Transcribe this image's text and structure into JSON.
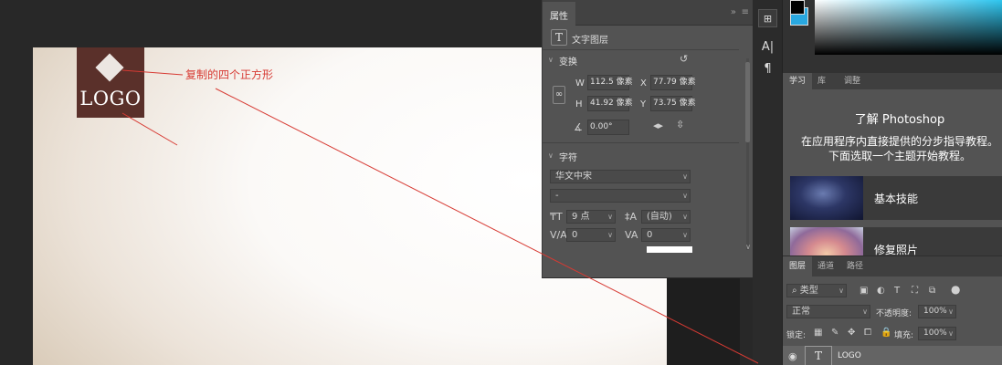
{
  "annotation": {
    "text": "复制的四个正方形"
  },
  "logo": {
    "text": "LOGO"
  },
  "properties": {
    "tab_label": "属性",
    "collapse_glyph": "»",
    "menu_glyph": "≡",
    "layer_kind_icon": "T",
    "layer_kind": "文字图层",
    "transform_section": "变换",
    "reset_icon": "reset-icon",
    "w_label": "W",
    "w_value": "112.5 像素",
    "h_label": "H",
    "h_value": "41.92 像素",
    "x_label": "X",
    "x_value": "77.79 像素",
    "y_label": "Y",
    "y_value": "73.75 像素",
    "angle_value": "0.00°",
    "character_section": "字符",
    "font_family": "华文中宋",
    "font_style": "-",
    "font_size": "9 点",
    "leading": "(自动)",
    "kerning": "0",
    "tracking": "0"
  },
  "colors": {
    "foreground": "#000000",
    "background": "#29a8e0",
    "annotation": "#d73a33",
    "logo_box": "#5a302a"
  },
  "learn": {
    "tabs": [
      "学习",
      "库",
      "调整"
    ],
    "title": "了解 Photoshop",
    "desc_line1": "在应用程序内直接提供的分步指导教程。",
    "desc_line2": "下面选取一个主题开始教程。",
    "cards": [
      {
        "label": "基本技能"
      },
      {
        "label": "修复照片"
      }
    ]
  },
  "layers": {
    "tabs": [
      "图层",
      "通道",
      "路径"
    ],
    "filter_kind": "类型",
    "blend_mode": "正常",
    "opacity_label": "不透明度:",
    "opacity_value": "100%",
    "lock_label": "锁定:",
    "fill_label": "填充:",
    "fill_value": "100%",
    "layer_thumb": "T",
    "layer_name": "LOGO"
  },
  "tools": {
    "glyph_a": "A|",
    "glyph_pilcrow": "¶"
  }
}
